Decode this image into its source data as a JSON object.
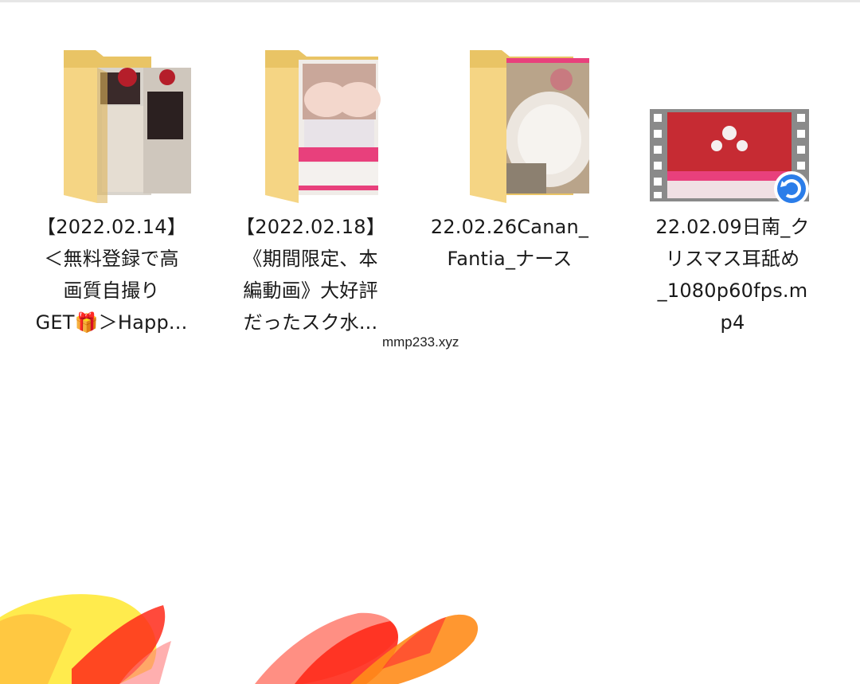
{
  "files": [
    {
      "kind": "folder",
      "icon": "folder-with-photo-icon",
      "name": "【2022.02.14】\n＜無料登録で高\n画質自撮り\nGET🎁＞Happ..."
    },
    {
      "kind": "folder",
      "icon": "folder-with-photo-icon",
      "name": "【2022.02.18】\n《期間限定、本\n編動画》大好評\nだったスク水..."
    },
    {
      "kind": "folder",
      "icon": "folder-with-photo-icon",
      "name": "22.02.26Canan_\nFantia_ナース"
    },
    {
      "kind": "video",
      "icon": "video-filmstrip-icon",
      "name": "22.02.09日南_ク\nリスマス耳舐め\n_1080p60fps.m\np4"
    }
  ],
  "watermark": "mmp233.xyz",
  "colors": {
    "folder": "#f5d584",
    "folder_back": "#e9c465",
    "folder_shade": "#dcb45a",
    "film": "#8a8a8a",
    "film_hole": "#ffffff",
    "pink_band": "#e8407c",
    "red_shirt": "#c8141e",
    "sync_badge": "#2b7de9",
    "brush_red": "#ff2a1a",
    "brush_yellow": "#ffe93a",
    "brush_orange": "#ff8c1a"
  }
}
